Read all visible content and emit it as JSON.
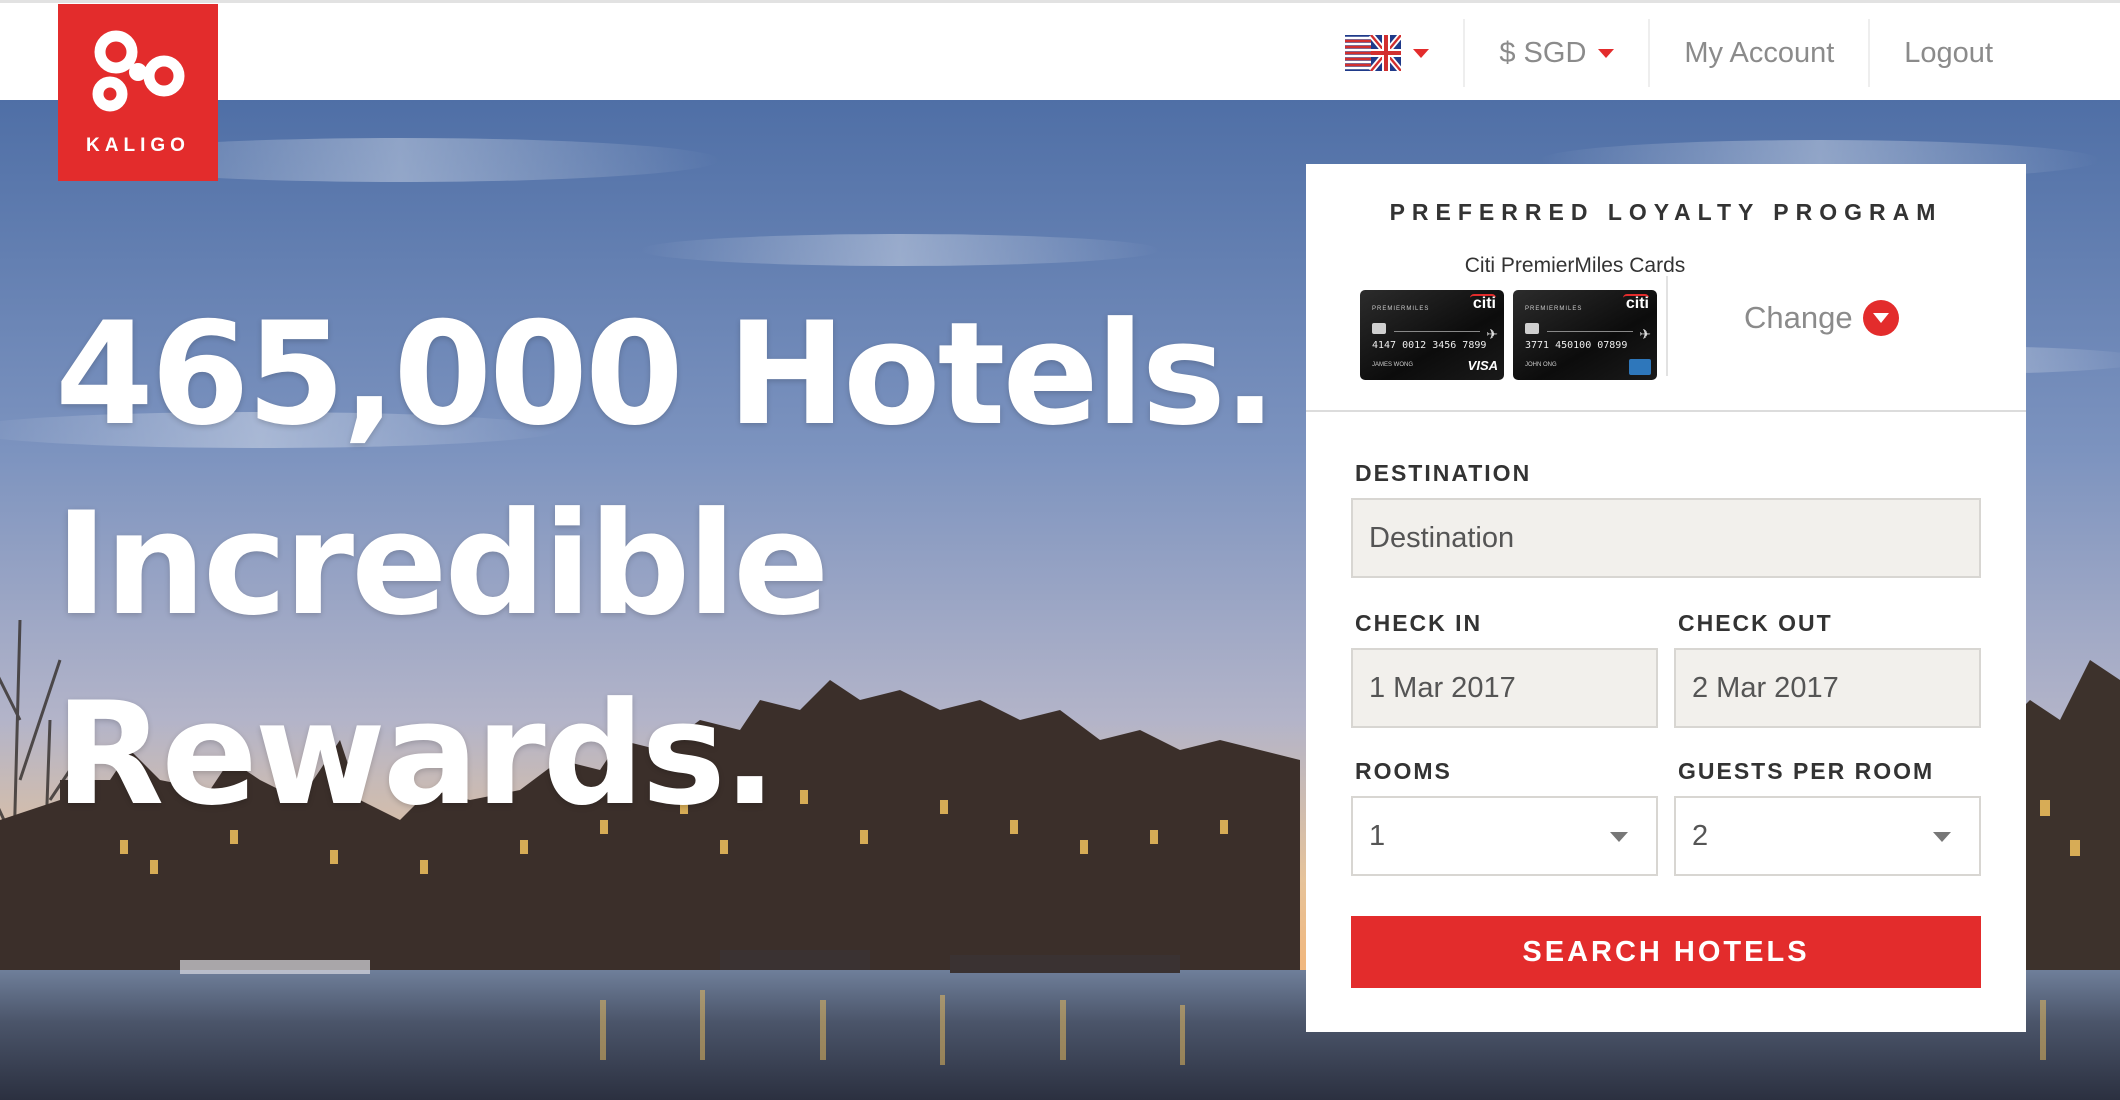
{
  "brand": {
    "logo_text": "KALIGO",
    "accent_color": "#e32c2c"
  },
  "nav": {
    "language_flag": "uk-flag-icon",
    "currency_label": "$ SGD",
    "my_account_label": "My Account",
    "logout_label": "Logout"
  },
  "hero": {
    "line1": "465,000 Hotels.",
    "line2": "Incredible",
    "line3": "Rewards."
  },
  "loyalty": {
    "title": "PREFERRED LOYALTY PROGRAM",
    "program_name": "Citi PremierMiles Cards",
    "cards": [
      {
        "brand": "citi",
        "program": "PREMIERMILES",
        "number": "4147 0012 3456 7899",
        "holder": "JAMES WONG",
        "network": "VISA"
      },
      {
        "brand": "citi",
        "program": "PREMIERMILES",
        "number": "3771 450100 07899",
        "holder": "JOHN ONG",
        "network": "AMEX"
      }
    ],
    "change_label": "Change"
  },
  "search": {
    "destination_label": "DESTINATION",
    "destination_placeholder": "Destination",
    "checkin_label": "CHECK IN",
    "checkin_value": "1 Mar 2017",
    "checkout_label": "CHECK OUT",
    "checkout_value": "2 Mar 2017",
    "rooms_label": "ROOMS",
    "rooms_value": "1",
    "guests_label": "GUESTS PER ROOM",
    "guests_value": "2",
    "search_button": "SEARCH HOTELS"
  }
}
